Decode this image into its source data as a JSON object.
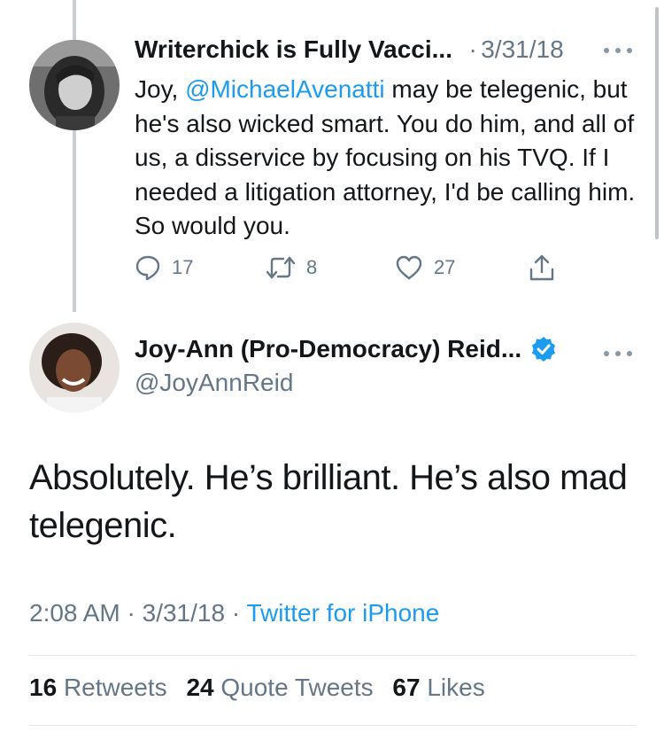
{
  "reply": {
    "author_name": "Writerchick is Fully Vacci...",
    "date": "3/31/18",
    "separator": "·",
    "text_before_mention": "Joy, ",
    "mention": "@MichaelAvenatti",
    "text_after_mention": " may be telegenic, but he's also wicked smart. You do him, and all of us, a disservice by focusing on his TVQ. If I needed a litigation attorney, I'd be calling him. So would you.",
    "actions": {
      "replies": "17",
      "retweets": "8",
      "likes": "27"
    }
  },
  "tweet": {
    "author_name": "Joy-Ann (Pro-Democracy) Reid...",
    "handle": "@JoyAnnReid",
    "text": "Absolutely. He’s brilliant. He’s also mad telegenic.",
    "time": "2:08 AM",
    "date": "3/31/18",
    "source": "Twitter for iPhone",
    "separator": "·"
  },
  "stats": {
    "retweets_count": "16",
    "retweets_label": "Retweets",
    "quotes_count": "24",
    "quotes_label": "Quote Tweets",
    "likes_count": "67",
    "likes_label": "Likes"
  },
  "colors": {
    "link": "#1d9bf0",
    "secondary_text": "#657786",
    "verified": "#1d9bf0"
  }
}
